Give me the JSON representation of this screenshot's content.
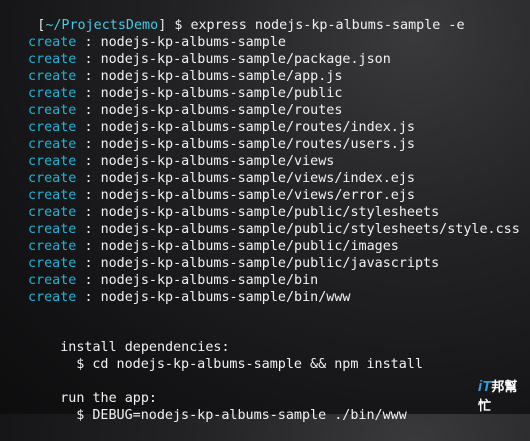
{
  "terminal": {
    "prompt_open": "[",
    "prompt_path": "~/ProjectsDemo",
    "prompt_close": "]",
    "prompt_symbol": "$",
    "command": "express nodejs-kp-albums-sample -e",
    "create_label": "create",
    "separator": ":",
    "created_paths": [
      "nodejs-kp-albums-sample",
      "nodejs-kp-albums-sample/package.json",
      "nodejs-kp-albums-sample/app.js",
      "nodejs-kp-albums-sample/public",
      "nodejs-kp-albums-sample/routes",
      "nodejs-kp-albums-sample/routes/index.js",
      "nodejs-kp-albums-sample/routes/users.js",
      "nodejs-kp-albums-sample/views",
      "nodejs-kp-albums-sample/views/index.ejs",
      "nodejs-kp-albums-sample/views/error.ejs",
      "nodejs-kp-albums-sample/public/stylesheets",
      "nodejs-kp-albums-sample/public/stylesheets/style.css",
      "nodejs-kp-albums-sample/public/images",
      "nodejs-kp-albums-sample/public/javascripts",
      "nodejs-kp-albums-sample/bin",
      "nodejs-kp-albums-sample/bin/www"
    ],
    "install_heading": "install dependencies:",
    "install_command": "$ cd nodejs-kp-albums-sample && npm install",
    "run_heading": "run the app:",
    "run_command": "$ DEBUG=nodejs-kp-albums-sample ./bin/www"
  },
  "watermark": {
    "prefix": "iT",
    "text": "邦幫忙"
  },
  "colors": {
    "create": "#20b4d8",
    "prompt_path": "#49c9e4",
    "text": "#f2f2f2"
  }
}
